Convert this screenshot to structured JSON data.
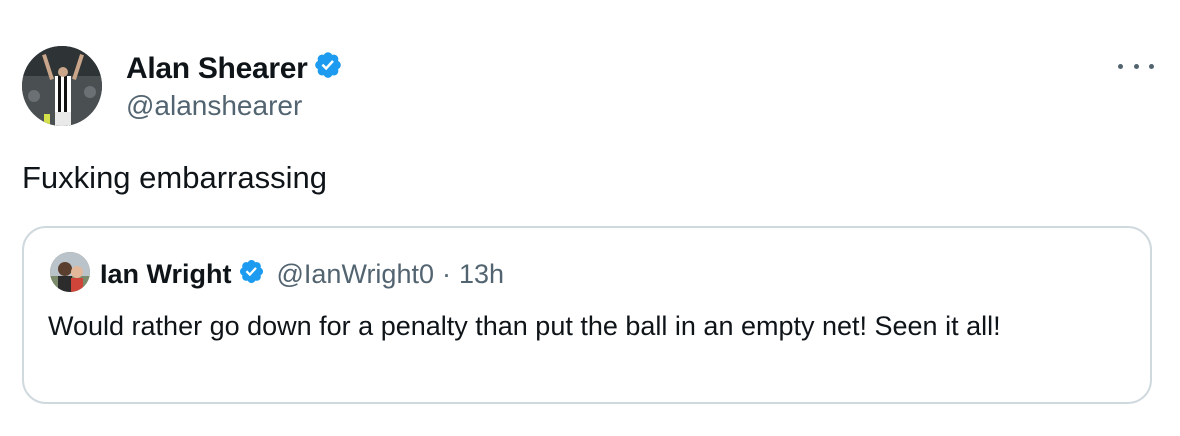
{
  "tweet": {
    "author_name": "Alan Shearer",
    "handle": "@alanshearer",
    "text": "Fuxking embarrassing"
  },
  "quoted_tweet": {
    "author_name": "Ian Wright",
    "handle": "@IanWright0",
    "separator": "·",
    "time": "13h",
    "text": "Would rather go down for a penalty than put the ball in an empty net! Seen it all!"
  },
  "icons": {
    "verified": "verified-badge-icon",
    "more": "more-options-icon"
  },
  "colors": {
    "verified_blue": "#1d9bf0",
    "secondary_text": "#536471",
    "border": "#cfd9de"
  }
}
